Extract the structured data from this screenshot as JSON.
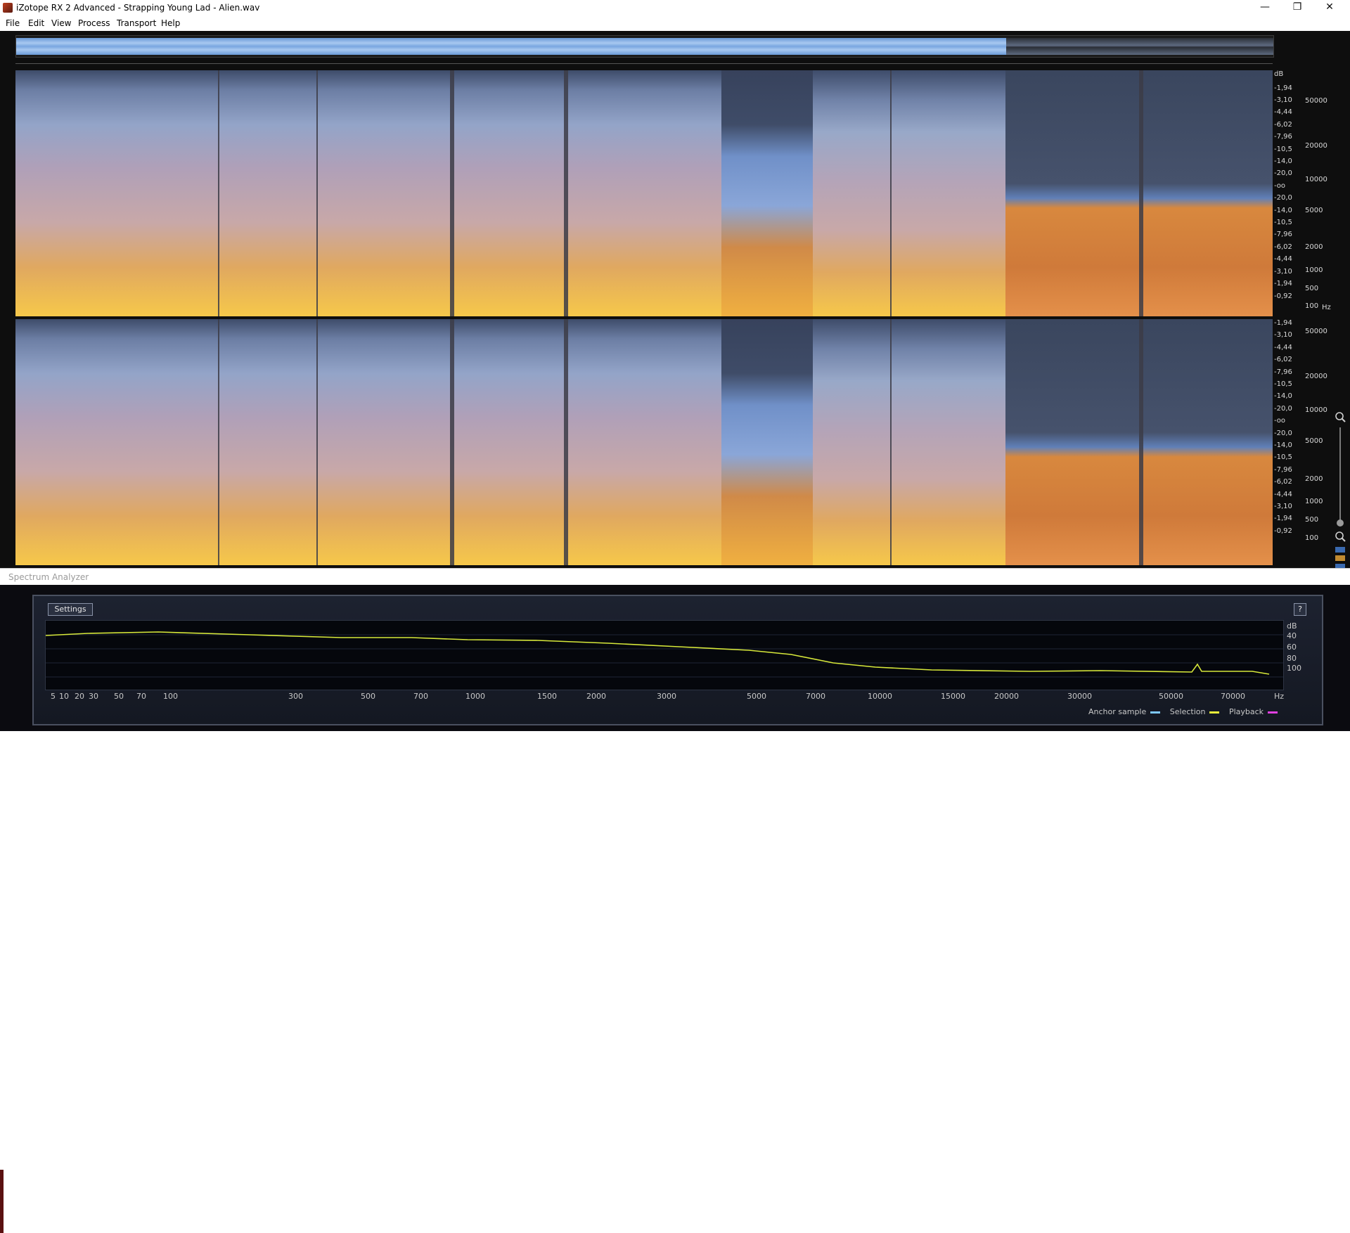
{
  "window": {
    "title": "iZotope RX 2 Advanced - Strapping Young Lad - Alien.wav",
    "minimize": "—",
    "maximize": "❐",
    "close": "✕"
  },
  "menu": [
    {
      "label": "File"
    },
    {
      "label": "Edit"
    },
    {
      "label": "View"
    },
    {
      "label": "Process"
    },
    {
      "label": "Transport"
    },
    {
      "label": "Help"
    }
  ],
  "spectrogram_scale": {
    "db_unit": "dB",
    "hz_unit": "Hz",
    "channel1_db": [
      "-1,94",
      "-3,10",
      "-4,44",
      "-6,02",
      "-7,96",
      "-10,5",
      "-14,0",
      "-20,0",
      "-oo",
      "-20,0",
      "-14,0",
      "-10,5",
      "-7,96",
      "-6,02",
      "-4,44",
      "-3,10",
      "-1,94",
      "-0,92"
    ],
    "channel1_hz": [
      "50000",
      "20000",
      "10000",
      "5000",
      "2000",
      "1000",
      "500",
      "100"
    ],
    "channel2_db": [
      "-1,94",
      "-3,10",
      "-4,44",
      "-6,02",
      "-7,96",
      "-10,5",
      "-14,0",
      "-20,0",
      "-oo",
      "-20,0",
      "-14,0",
      "-10,5",
      "-7,96",
      "-6,02",
      "-4,44",
      "-3,10",
      "-1,94",
      "-0,92"
    ],
    "channel2_hz": [
      "50000",
      "20000",
      "10000",
      "5000",
      "2000",
      "1000",
      "500",
      "100"
    ]
  },
  "colors": {
    "spectrogram_high": "#f4c050",
    "spectrogram_mid": "#d98a4a",
    "spectrogram_low": "#8c9cc4",
    "spectrogram_top": "#3c4a66",
    "overview_wave": "#8fb6ea",
    "analyzer_curve": "#d7e83a",
    "anchor_swatch": "#7ec8ff",
    "selection_swatch": "#e9f23a",
    "playback_swatch": "#e040e0"
  },
  "spectrum_analyzer": {
    "panel_title": "Spectrum Analyzer",
    "settings_label": "Settings",
    "help_label": "?",
    "db_labels": [
      "dB",
      "40",
      "60",
      "80",
      "100"
    ],
    "freq_labels": [
      "5",
      "10",
      "20",
      "30",
      "50",
      "70",
      "100",
      "300",
      "500",
      "700",
      "1000",
      "1500",
      "2000",
      "3000",
      "5000",
      "7000",
      "10000",
      "15000",
      "20000",
      "30000",
      "50000",
      "70000",
      "Hz"
    ],
    "legend": {
      "anchor": "Anchor sample",
      "selection": "Selection",
      "playback": "Playback"
    }
  }
}
